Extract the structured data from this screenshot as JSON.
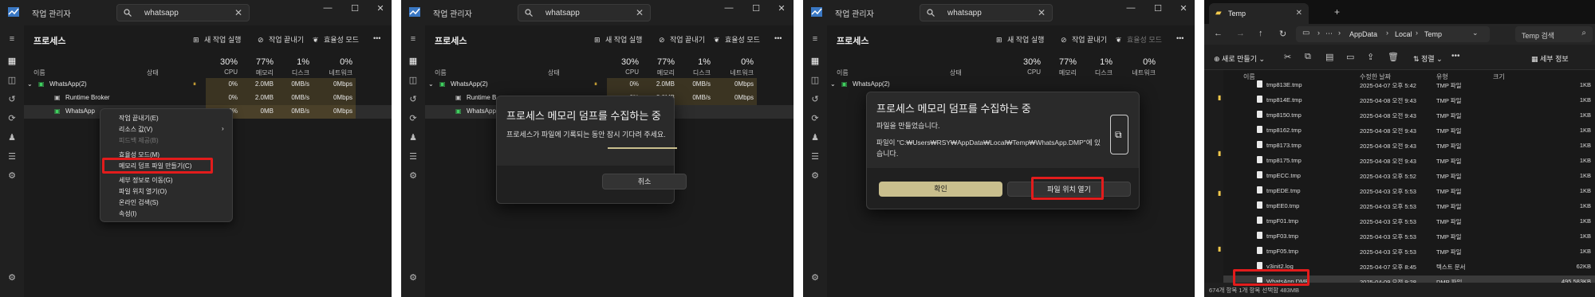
{
  "task_manager": {
    "title": "작업 관리자",
    "search_value": "whatsapp",
    "page_title": "프로세스",
    "toolbar": {
      "run_new_task": "새 작업 실행",
      "end_task": "작업 끝내기",
      "efficiency_mode": "효율성 모드",
      "more": "•••"
    },
    "columns": {
      "name": "이름",
      "status": "상태",
      "cpu_pct": "30%",
      "cpu": "CPU",
      "mem_pct": "77%",
      "mem": "메모리",
      "disk_pct": "1%",
      "disk": "디스크",
      "net_pct": "0%",
      "net": "네트워크"
    },
    "rows": [
      {
        "name": "WhatsApp(2)",
        "cpu": "0%",
        "mem": "2.0MB",
        "disk": "0MB/s",
        "net": "0Mbps"
      },
      {
        "name": "Runtime Broker",
        "cpu": "0%",
        "mem": "2.0MB",
        "disk": "0MB/s",
        "net": "0Mbps"
      },
      {
        "name": "WhatsApp",
        "cpu": "0%",
        "mem": "0MB",
        "disk": "0MB/s",
        "net": "0Mbps"
      }
    ],
    "row2_partial": "Runtime B",
    "row3_partial": "WhatsApp",
    "row1_partial": "WhatsApp(2)"
  },
  "context_menu": {
    "items": [
      "작업 끝내기(E)",
      "리소스 값(V)",
      "피드백 제공(B)",
      "효율성 모드(M)",
      "메모리 덤프 파일 만들기(C)",
      "세부 정보로 이동(G)",
      "파일 위치 열기(O)",
      "온라인 검색(S)",
      "속성(I)"
    ]
  },
  "dialog_progress": {
    "title": "프로세스 메모리 덤프를 수집하는 중",
    "message": "프로세스가 파일에 기록되는 동안 잠시 기다려 주세요.",
    "cancel": "취소"
  },
  "dialog_done": {
    "title": "프로세스 메모리 덤프를 수집하는 중",
    "line1": "파일을 만들었습니다.",
    "line2": "파일이 \"C:₩Users₩RSY₩AppData₩Local₩Temp₩WhatsApp.DMP\"에 있",
    "line3": "습니다.",
    "ok": "확인",
    "open_location": "파일 위치 열기"
  },
  "explorer": {
    "tab_title": "Temp",
    "breadcrumb": [
      "AppData",
      "Local",
      "Temp"
    ],
    "search_placeholder": "Temp 검색",
    "new_label": "새로 만들기",
    "sort_label": "정렬",
    "details_label": "세부 정보",
    "columns": {
      "name": "이름",
      "date": "수정한 날짜",
      "type": "유형",
      "size": "크기"
    },
    "files": [
      {
        "name": "tmp813E.tmp",
        "date": "2025-04-07 오후 5:42",
        "type": "TMP 파일",
        "size": "1KB"
      },
      {
        "name": "tmp814E.tmp",
        "date": "2025-04-08 오전 9:43",
        "type": "TMP 파일",
        "size": "1KB"
      },
      {
        "name": "tmp8150.tmp",
        "date": "2025-04-08 오전 9:43",
        "type": "TMP 파일",
        "size": "1KB"
      },
      {
        "name": "tmp8162.tmp",
        "date": "2025-04-08 오전 9:43",
        "type": "TMP 파일",
        "size": "1KB"
      },
      {
        "name": "tmp8173.tmp",
        "date": "2025-04-08 오전 9:43",
        "type": "TMP 파일",
        "size": "1KB"
      },
      {
        "name": "tmp8175.tmp",
        "date": "2025-04-08 오전 9:43",
        "type": "TMP 파일",
        "size": "1KB"
      },
      {
        "name": "tmpECC.tmp",
        "date": "2025-04-03 오후 5:52",
        "type": "TMP 파일",
        "size": "1KB"
      },
      {
        "name": "tmpEDE.tmp",
        "date": "2025-04-03 오후 5:53",
        "type": "TMP 파일",
        "size": "1KB"
      },
      {
        "name": "tmpEE0.tmp",
        "date": "2025-04-03 오후 5:53",
        "type": "TMP 파일",
        "size": "1KB"
      },
      {
        "name": "tmpF01.tmp",
        "date": "2025-04-03 오후 5:53",
        "type": "TMP 파일",
        "size": "1KB"
      },
      {
        "name": "tmpF03.tmp",
        "date": "2025-04-03 오후 5:53",
        "type": "TMP 파일",
        "size": "1KB"
      },
      {
        "name": "tmpF05.tmp",
        "date": "2025-04-03 오후 5:53",
        "type": "TMP 파일",
        "size": "1KB"
      },
      {
        "name": "v3init2.log",
        "date": "2025-04-07 오후 8:45",
        "type": "텍스트 문서",
        "size": "62KB"
      },
      {
        "name": "WhatsApp.DMP",
        "date": "2025-04-09 오전 9:28",
        "type": "DMP 파일",
        "size": "495,583KB"
      }
    ],
    "status": "674개 항목  1개 항목 선택함 483MB"
  },
  "colors": {
    "highlight_red": "#e21c1c",
    "amber_cell": "#3b3422",
    "confirm_button": "#c9bf8e"
  }
}
